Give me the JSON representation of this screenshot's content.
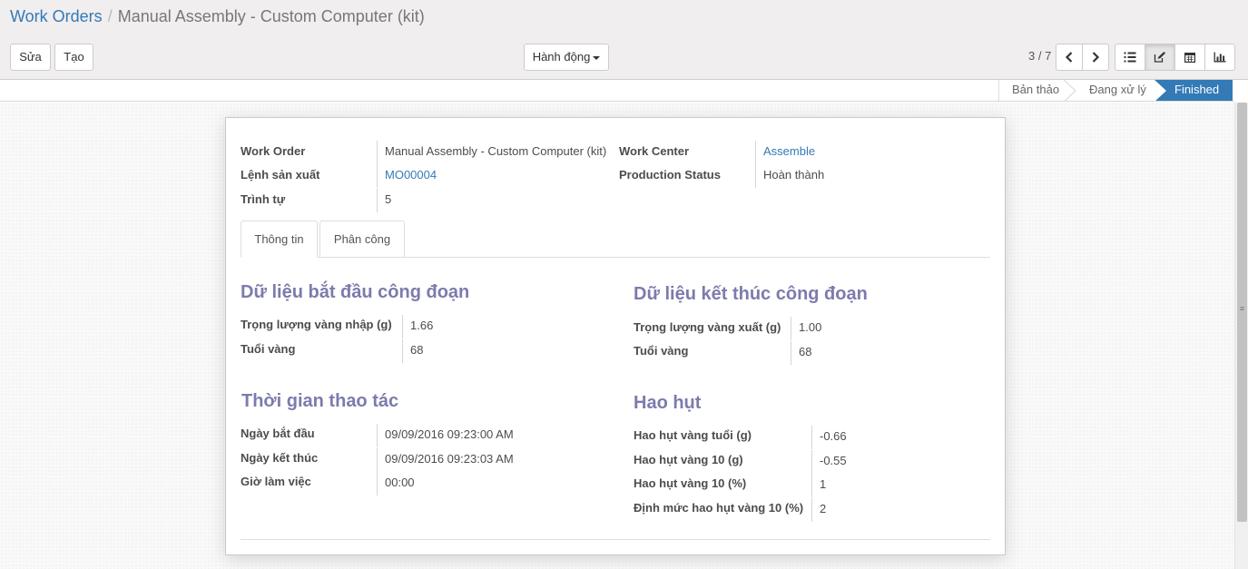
{
  "breadcrumb": {
    "root": "Work Orders",
    "separator": "/",
    "current": "Manual Assembly - Custom Computer (kit)"
  },
  "toolbar": {
    "edit_label": "Sửa",
    "create_label": "Tạo",
    "action_label": "Hành động"
  },
  "pager": {
    "value": "3 / 7"
  },
  "views": [
    "list-icon",
    "form-icon",
    "calendar-icon",
    "graph-icon"
  ],
  "statusbar": {
    "stages": [
      "Bản thảo",
      "Đang xử lý",
      "Finished"
    ],
    "active": "Finished",
    "active_color": "#337ab7"
  },
  "header_fields": {
    "work_order_label": "Work Order",
    "work_order_value": "Manual Assembly - Custom Computer (kit)",
    "mo_label": "Lệnh sản xuất",
    "mo_value": "MO00004",
    "sequence_label": "Trình tự",
    "sequence_value": "5",
    "work_center_label": "Work Center",
    "work_center_value": "Assemble",
    "status_label": "Production Status",
    "status_value": "Hoàn thành"
  },
  "tabs": [
    {
      "label": "Thông tin"
    },
    {
      "label": "Phân công"
    }
  ],
  "start_section": {
    "title": "Dữ liệu bắt đầu công đoạn",
    "weight_in_label": "Trọng lượng vàng nhập (g)",
    "weight_in_value": "1.66",
    "age_label": "Tuổi vàng",
    "age_value": "68"
  },
  "end_section": {
    "title": "Dữ liệu kết thúc công đoạn",
    "weight_out_label": "Trọng lượng vàng xuất (g)",
    "weight_out_value": "1.00",
    "age_label": "Tuổi vàng",
    "age_value": "68"
  },
  "time_section": {
    "title": "Thời gian thao tác",
    "start_label": "Ngày bắt đầu",
    "start_value": "09/09/2016 09:23:00 AM",
    "end_label": "Ngày kết thúc",
    "end_value": "09/09/2016 09:23:03 AM",
    "hours_label": "Giờ làm việc",
    "hours_value": "00:00"
  },
  "loss_section": {
    "title": "Hao hụt",
    "loss_age_label": "Hao hụt vàng tuổi (g)",
    "loss_age_value": "-0.66",
    "loss10_g_label": "Hao hụt vàng 10 (g)",
    "loss10_g_value": "-0.55",
    "loss10_pct_label": "Hao hụt vàng 10 (%)",
    "loss10_pct_value": "1",
    "norm_label": "Định mức hao hụt vàng 10 (%)",
    "norm_value": "2"
  }
}
